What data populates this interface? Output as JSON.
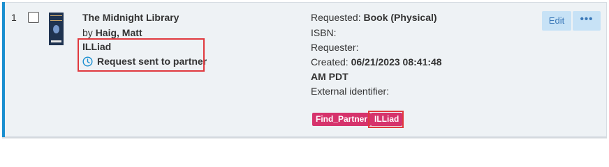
{
  "row": {
    "number": "1",
    "title": "The Midnight Library",
    "author_prefix": "by",
    "author": "Haig, Matt",
    "source": "ILLiad",
    "status": "Request sent to partner",
    "status_icon": "clock-icon"
  },
  "details": {
    "requested_label": "Requested:",
    "requested_value": "Book (Physical)",
    "isbn_label": "ISBN:",
    "requester_label": "Requester:",
    "created_label": "Created:",
    "created_value_line1": "06/21/2023 08:41:48",
    "created_value_line2": "AM PDT",
    "external_label": "External identifier:"
  },
  "tags": [
    "Find_Partner",
    "ILLiad"
  ],
  "actions": {
    "edit_label": "Edit",
    "more_label": "•••"
  },
  "colors": {
    "accent": "#1a8fd0",
    "tag": "#d6336c",
    "highlight": "#e0393e",
    "button_bg": "#c7e2f6",
    "button_text": "#3a78b8"
  }
}
